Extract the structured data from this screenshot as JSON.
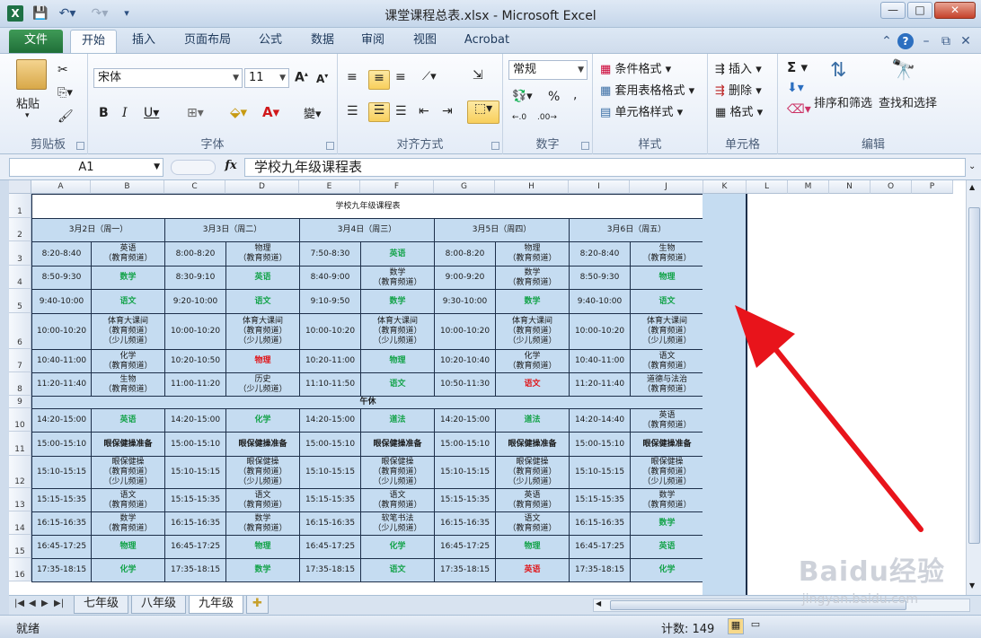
{
  "window": {
    "title": "课堂课程总表.xlsx - Microsoft Excel",
    "app_icon_label": "X",
    "controls": {
      "minimize": "—",
      "maximize": "□",
      "close": "✕"
    }
  },
  "tabs": [
    "文件",
    "开始",
    "插入",
    "页面布局",
    "公式",
    "数据",
    "审阅",
    "视图",
    "Acrobat"
  ],
  "ribbon": {
    "clipboard": {
      "paste": "粘贴",
      "label": "剪贴板"
    },
    "font": {
      "name": "宋体",
      "size": "11",
      "label": "字体"
    },
    "alignment": {
      "label": "对齐方式"
    },
    "number": {
      "format": "常规",
      "label": "数字"
    },
    "styles": {
      "conditional": "条件格式",
      "table": "套用表格格式",
      "cell": "单元格样式",
      "label": "样式"
    },
    "cells": {
      "insert": "插入",
      "delete": "删除",
      "format": "格式",
      "label": "单元格"
    },
    "editing": {
      "sort": "排序和筛选",
      "find": "查找和选择",
      "label": "编辑"
    }
  },
  "formula_bar": {
    "name_box": "A1",
    "fx": "fx",
    "value": "学校九年级课程表"
  },
  "columns": [
    "A",
    "B",
    "C",
    "D",
    "E",
    "F",
    "G",
    "H",
    "I",
    "J",
    "K",
    "L",
    "M",
    "N",
    "O",
    "P"
  ],
  "rows": [
    "1",
    "2",
    "3",
    "4",
    "5",
    "6",
    "7",
    "8",
    "9",
    "10",
    "11",
    "12",
    "13",
    "14",
    "15",
    "16"
  ],
  "sheet": {
    "title": "学校九年级课程表",
    "days": [
      "3月2日（周一）",
      "3月3日（周二）",
      "3月4日（周三）",
      "3月5日（周四）",
      "3月6日（周五）"
    ],
    "lunch": "午休",
    "rows": [
      [
        "8:20-8:40",
        "英语\n（教育频道）",
        "8:00-8:20",
        "物理\n（教育频道）",
        "7:50-8:30",
        "英语",
        "8:00-8:20",
        "物理\n（教育频道）",
        "8:20-8:40",
        "生物\n（教育频道）"
      ],
      [
        "8:50-9:30",
        "数学",
        "8:30-9:10",
        "英语",
        "8:40-9:00",
        "数学\n（教育频道）",
        "9:00-9:20",
        "数学\n（教育频道）",
        "8:50-9:30",
        "物理"
      ],
      [
        "9:40-10:00",
        "语文",
        "9:20-10:00",
        "语文",
        "9:10-9:50",
        "数学",
        "9:30-10:00",
        "数学",
        "9:40-10:00",
        "语文"
      ],
      [
        "10:00-10:20",
        "体育大课间\n（教育频道）\n（少儿频道）",
        "10:00-10:20",
        "体育大课间\n（教育频道）\n（少儿频道）",
        "10:00-10:20",
        "体育大课间\n（教育频道）\n（少儿频道）",
        "10:00-10:20",
        "体育大课间\n（教育频道）\n（少儿频道）",
        "10:00-10:20",
        "体育大课间\n（教育频道）\n（少儿频道）"
      ],
      [
        "10:40-11:00",
        "化学\n（教育频道）",
        "10:20-10:50",
        "物理",
        "10:20-11:00",
        "物理",
        "10:20-10:40",
        "化学\n（教育频道）",
        "10:40-11:00",
        "语文\n（教育频道）"
      ],
      [
        "11:20-11:40",
        "生物\n（教育频道）",
        "11:00-11:20",
        "历史\n（少儿频道）",
        "11:10-11:50",
        "语文",
        "10:50-11:30",
        "语文",
        "11:20-11:40",
        "道德与法治\n（教育频道）"
      ],
      [
        "14:20-15:00",
        "英语",
        "14:20-15:00",
        "化学",
        "14:20-15:00",
        "道法",
        "14:20-15:00",
        "道法",
        "14:20-14:40",
        "英语\n（教育频道）"
      ],
      [
        "15:00-15:10",
        "眼保健操准备",
        "15:00-15:10",
        "眼保健操准备",
        "15:00-15:10",
        "眼保健操准备",
        "15:00-15:10",
        "眼保健操准备",
        "15:00-15:10",
        "眼保健操准备"
      ],
      [
        "15:10-15:15",
        "眼保健操\n（教育频道）\n（少儿频道）",
        "15:10-15:15",
        "眼保健操\n（教育频道）\n（少儿频道）",
        "15:10-15:15",
        "眼保健操\n（教育频道）\n（少儿频道）",
        "15:10-15:15",
        "眼保健操\n（教育频道）\n（少儿频道）",
        "15:10-15:15",
        "眼保健操\n（教育频道）\n（少儿频道）"
      ],
      [
        "15:15-15:35",
        "语文\n（教育频道）",
        "15:15-15:35",
        "语文\n（教育频道）",
        "15:15-15:35",
        "语文\n（教育频道）",
        "15:15-15:35",
        "英语\n（教育频道）",
        "15:15-15:35",
        "数学\n（教育频道）"
      ],
      [
        "16:15-16:35",
        "数学\n（教育频道）",
        "16:15-16:35",
        "数学\n（教育频道）",
        "16:15-16:35",
        "软笔书法\n（少儿频道）",
        "16:15-16:35",
        "语文\n（教育频道）",
        "16:15-16:35",
        "数学"
      ],
      [
        "16:45-17:25",
        "物理",
        "16:45-17:25",
        "物理",
        "16:45-17:25",
        "化学",
        "16:45-17:25",
        "物理",
        "16:45-17:25",
        "英语"
      ],
      [
        "17:35-18:15",
        "化学",
        "17:35-18:15",
        "数学",
        "17:35-18:15",
        "语文",
        "17:35-18:15",
        "英语",
        "17:35-18:15",
        "化学"
      ]
    ],
    "row_styles": [
      [
        "",
        "",
        "",
        "",
        "",
        "green",
        "",
        "",
        "",
        ""
      ],
      [
        "",
        "green",
        "",
        "green",
        "",
        "",
        "",
        "",
        "",
        "green"
      ],
      [
        "",
        "green",
        "",
        "green",
        "",
        "green",
        "",
        "green",
        "",
        "green"
      ],
      [
        "",
        "",
        "",
        "",
        "",
        "",
        "",
        "",
        "",
        ""
      ],
      [
        "",
        "",
        "",
        "red",
        "",
        "green",
        "",
        "",
        "",
        ""
      ],
      [
        "",
        "",
        "",
        "",
        "",
        "green",
        "",
        "red",
        "",
        ""
      ],
      [
        "",
        "green",
        "",
        "green",
        "",
        "green",
        "",
        "green",
        "",
        ""
      ],
      [
        "",
        "bold",
        "",
        "bold",
        "",
        "bold",
        "",
        "bold",
        "",
        "bold"
      ],
      [
        "",
        "",
        "",
        "",
        "",
        "",
        "",
        "",
        "",
        ""
      ],
      [
        "",
        "",
        "",
        "",
        "",
        "",
        "",
        "",
        "",
        ""
      ],
      [
        "",
        "",
        "",
        "",
        "",
        "",
        "",
        "",
        "",
        "green"
      ],
      [
        "",
        "green",
        "",
        "green",
        "",
        "green",
        "",
        "green",
        "",
        "green"
      ],
      [
        "",
        "green",
        "",
        "green",
        "",
        "green",
        "",
        "red",
        "",
        "green"
      ]
    ]
  },
  "sheet_tabs": [
    "七年级",
    "八年级",
    "九年级"
  ],
  "active_sheet": "九年级",
  "status": {
    "ready": "就绪",
    "count": "计数: 149"
  },
  "watermark": {
    "brand": "Baidu经验",
    "url": "jingyan.baidu.com"
  },
  "annotation": {
    "arrow_color": "#e8141b"
  }
}
